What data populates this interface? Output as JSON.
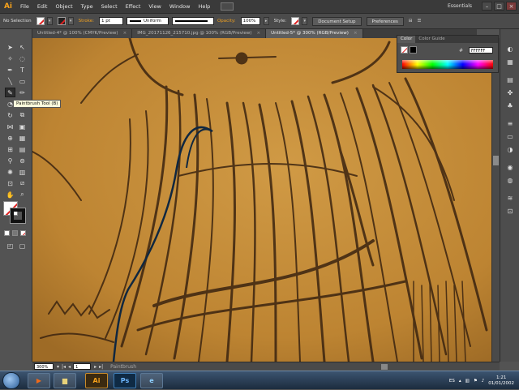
{
  "app": {
    "logo": "Ai",
    "menus": [
      "File",
      "Edit",
      "Object",
      "Type",
      "Select",
      "Effect",
      "View",
      "Window",
      "Help"
    ],
    "workspace": "Essentials"
  },
  "window_controls": [
    "–",
    "□",
    "×"
  ],
  "control_bar": {
    "selection": "No Selection",
    "stroke_label": "Stroke:",
    "stroke_weight": "1 pt",
    "profile": "Uniform",
    "opacity_label": "Opacity:",
    "opacity_value": "100%",
    "style_label": "Style:",
    "document_setup": "Document Setup",
    "preferences": "Preferences"
  },
  "tabs": [
    {
      "label": "Untitled-4* @ 100% (CMYK/Preview)",
      "active": false
    },
    {
      "label": "IMG_20171126_215710.jpg @ 100% (RGB/Preview)",
      "active": false
    },
    {
      "label": "Untitled-5* @ 300% (RGB/Preview)",
      "active": true
    }
  ],
  "tooltip": "Paintbrush Tool (B)",
  "color_panel": {
    "tabs": [
      "Color",
      "Color Guide"
    ],
    "hex": "FFFFFF"
  },
  "status_bar": {
    "zoom": "300%",
    "page": "1",
    "tool": "Paintbrush"
  },
  "taskbar": {
    "apps": [
      "Ai",
      "Ps"
    ],
    "language": "ES",
    "time": "1:21",
    "date": "01/01/2002"
  },
  "colors": {
    "accent": "#f7a21b",
    "canvas_paper": "#c18a37",
    "ink": "#3a2210",
    "stroke_path": "#0f2740"
  }
}
